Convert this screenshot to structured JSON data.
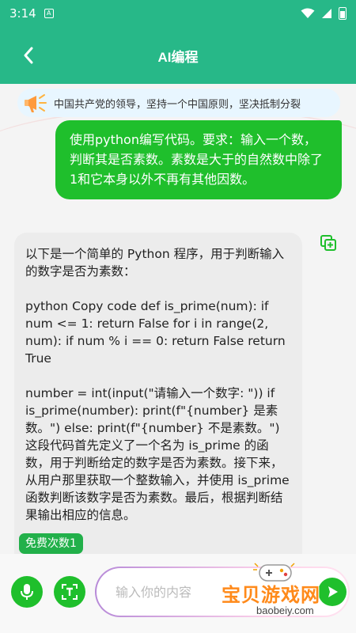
{
  "status_bar": {
    "time": "3:14",
    "app_icon_letter": "A"
  },
  "nav": {
    "title": "AI编程"
  },
  "notice": {
    "text": "中国共产党的领导，坚持一个中国原则，坚决抵制分裂"
  },
  "user_message": "使用python编写代码。要求：输入一个数，判断其是否素数。素数是大于的自然数中除了1和它本身以外不再有其他因数。",
  "ai_message": {
    "paragraphs": [
      "以下是一个简单的 Python 程序，用于判断输入的数字是否为素数：",
      "python Copy code def is_prime(num): if num <= 1: return False for i in range(2, num): if num % i == 0: return False return True",
      "number = int(input(\"请输入一个数字: \")) if is_prime(number): print(f\"{number} 是素数。\") else: print(f\"{number} 不是素数。\") 这段代码首先定义了一个名为 is_prime 的函数，用于判断给定的数字是否为素数。接下来，从用户那里获取一个整数输入，并使用 is_prime 函数判断该数字是否为素数。最后，根据判断结果输出相应的信息。"
    ]
  },
  "free_count_label": "免费次数1",
  "input": {
    "placeholder": "输入你的内容"
  },
  "watermark": {
    "text": "宝贝游戏网",
    "url": "baobeiy.com"
  },
  "colors": {
    "header": "#27b888",
    "accent": "#1fbf2c",
    "notice_bg": "#e8f6ff"
  },
  "icons": [
    "back-arrow-icon",
    "megaphone-icon",
    "copy-icon",
    "microphone-icon",
    "text-scan-icon",
    "send-icon",
    "wifi-icon",
    "signal-icon",
    "battery-icon"
  ]
}
